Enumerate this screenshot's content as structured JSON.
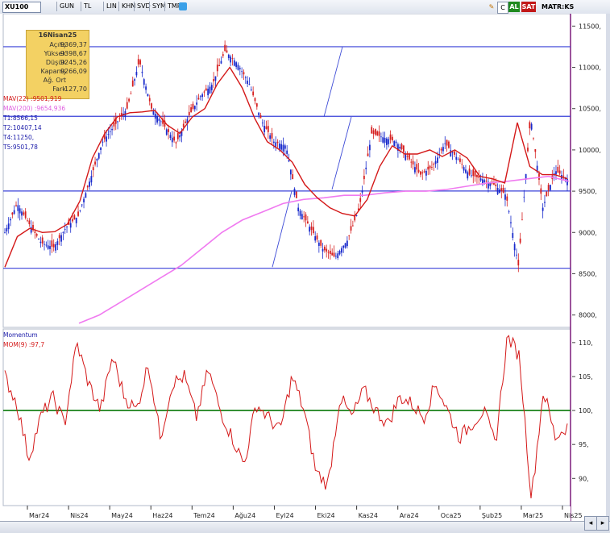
{
  "toolbar": {
    "symbol": "XU100",
    "period": "GUN",
    "currency": "TL",
    "scale_buttons": [
      "LIN",
      "KHN",
      "SVD",
      "SYM",
      "TMP"
    ],
    "buy_label": "AL",
    "sell_label": "SAT",
    "right_label": "MATR:KS",
    "c_label": "C"
  },
  "legend": {
    "date": "16Nisan25",
    "rows": [
      {
        "k": "Açılış",
        "v": "9369,37"
      },
      {
        "k": "Yüksek",
        "v": "9398,67"
      },
      {
        "k": "Düşük",
        "v": "9245,26"
      },
      {
        "k": "Kapanış",
        "v": "9266,09"
      },
      {
        "k": "Ağ. Ort",
        "v": ""
      },
      {
        "k": "Fark",
        "v": "-127,70"
      }
    ]
  },
  "indicators": {
    "mav22": "MAV(22)",
    "mav22_val": ":9501,919",
    "mav200": "MAV(200)",
    "mav200_val": ":9654,936",
    "t1": "T1:8566,15",
    "t2": "T2:10407,14",
    "t4": "T4:11250,",
    "t5": "T5:9501,78",
    "momentum_title": "Momentum",
    "mom": "MOM(9)",
    "mom_val": ":97,7"
  },
  "chart_data": [
    {
      "type": "candlestick",
      "title": "",
      "x_ticks": [
        "Mar24",
        "Nis24",
        "May24",
        "Haz24",
        "Tem24",
        "Ağu24",
        "Eyl24",
        "Eki24",
        "Kas24",
        "Ara24",
        "Oca25",
        "Şub25",
        "Mar25",
        "Nis25"
      ],
      "y_ticks": [
        8000,
        8500,
        9000,
        9500,
        10000,
        10500,
        11000,
        11500
      ],
      "y_tick_labels": [
        "8000,",
        "8500,",
        "9000,",
        "9500,",
        "10000,",
        "10500,",
        "11000,",
        "11500,"
      ],
      "y_range": [
        7850,
        11650
      ],
      "horizontal_levels": [
        8566.15,
        9501.78,
        10407.14,
        11250
      ],
      "price_series": [
        9000,
        9350,
        9100,
        8870,
        8820,
        9060,
        9200,
        9650,
        10100,
        10300,
        10500,
        11080,
        10500,
        10300,
        10080,
        10400,
        10650,
        10800,
        11200,
        11050,
        10800,
        10350,
        10100,
        10050,
        9300,
        9050,
        8800,
        8700,
        8900,
        9300,
        10200,
        10150,
        10100,
        9900,
        9700,
        9800,
        10080,
        9900,
        9700,
        9650,
        9580,
        9450,
        8600,
        10400,
        9300,
        9750,
        9650
      ],
      "mav22_series": [
        8580,
        8950,
        9050,
        9000,
        9010,
        9100,
        9380,
        9900,
        10200,
        10400,
        10450,
        10460,
        10480,
        10300,
        10200,
        10400,
        10500,
        10800,
        11000,
        10750,
        10380,
        10100,
        10000,
        9850,
        9580,
        9420,
        9300,
        9230,
        9200,
        9400,
        9800,
        10050,
        9950,
        9950,
        10000,
        9920,
        10000,
        9900,
        9680,
        9650,
        9600,
        10330,
        9800,
        9700,
        9700,
        9650
      ],
      "mav200_series": [
        7900,
        8000,
        8150,
        8300,
        8450,
        8600,
        8800,
        9000,
        9150,
        9250,
        9350,
        9400,
        9420,
        9450,
        9450,
        9480,
        9500,
        9500,
        9520,
        9560,
        9600,
        9620,
        9650,
        9680,
        9620
      ],
      "colors": {
        "up": "#1a2bcc",
        "down": "#d62020",
        "mav22": "#d41818",
        "mav200": "#f07af0",
        "level": "#3840d8",
        "trend": "#3d4bd6"
      }
    },
    {
      "type": "line",
      "title": "Momentum",
      "y_ticks": [
        90,
        95,
        100,
        105,
        110
      ],
      "y_tick_labels": [
        "90,",
        "95,",
        "100,",
        "105,",
        "110,"
      ],
      "y_range": [
        86,
        112
      ],
      "reference_line": 100,
      "mom_series": [
        105,
        101,
        93,
        99,
        102,
        98,
        110,
        104,
        100,
        108,
        102,
        100,
        107,
        96,
        104,
        105,
        99,
        106,
        100,
        96,
        92,
        101,
        99,
        97,
        105,
        100,
        91,
        89,
        102,
        99,
        103,
        100,
        98,
        102,
        101,
        99,
        104,
        100,
        96,
        98,
        100,
        95,
        111,
        108,
        87,
        103,
        96,
        97.7
      ],
      "colors": {
        "line": "#d41818",
        "reference": "#0a7a0a"
      }
    }
  ]
}
